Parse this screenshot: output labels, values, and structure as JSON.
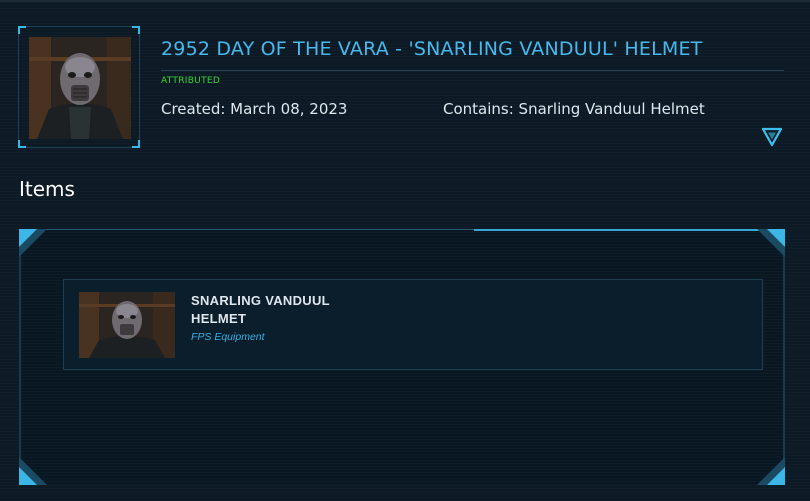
{
  "pledge": {
    "title": "2952 DAY OF THE VARA - 'SNARLING VANDUUL' HELMET",
    "status": "ATTRIBUTED",
    "created": "Created: March 08, 2023",
    "contains": "Contains: Snarling Vanduul Helmet",
    "thumbnail_icon": "vanduul-helmet-portrait",
    "expand_icon": "triangle-down-icon"
  },
  "items_section": {
    "heading": "Items",
    "items": [
      {
        "name": "SNARLING VANDUUL HELMET",
        "type": "FPS Equipment",
        "thumbnail_icon": "vanduul-helmet-portrait"
      }
    ]
  },
  "colors": {
    "accent": "#46b9ee",
    "status_green": "#39d339",
    "background": "#0c1a26"
  }
}
